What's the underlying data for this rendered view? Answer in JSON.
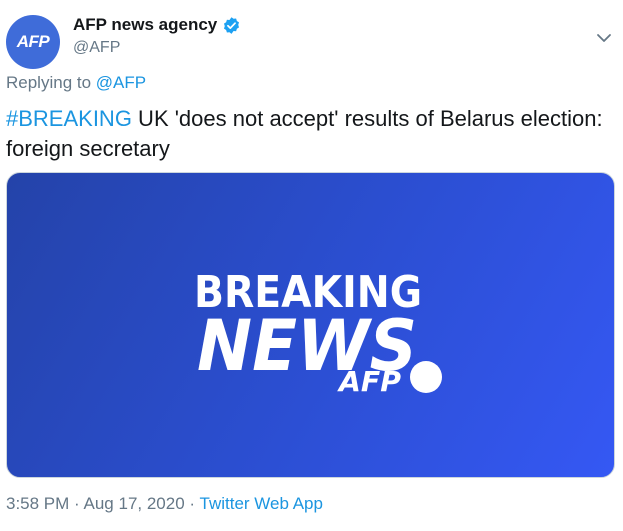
{
  "tweet": {
    "author": {
      "avatar_text": "AFP",
      "display_name": "AFP news agency",
      "handle": "@AFP",
      "verified": true
    },
    "reply": {
      "prefix": "Replying to",
      "mention": "@AFP"
    },
    "text": {
      "hashtag": "#BREAKING",
      "body": " UK 'does not accept' results of Belarus election: foreign secretary"
    },
    "media": {
      "line1": "BREAKING",
      "line2": "NEWS",
      "brand": "AFP"
    },
    "meta": {
      "time": "3:58 PM",
      "separator": "·",
      "date": "Aug 17, 2020",
      "source": "Twitter Web App"
    }
  },
  "colors": {
    "link": "#1b95e0",
    "muted": "#657786",
    "avatar_bg": "#3f6cd9",
    "card_gradient_start": "#2443a9",
    "card_gradient_end": "#3558f4"
  },
  "icons": {
    "verified": "verified-badge-icon",
    "more": "chevron-down-icon"
  }
}
